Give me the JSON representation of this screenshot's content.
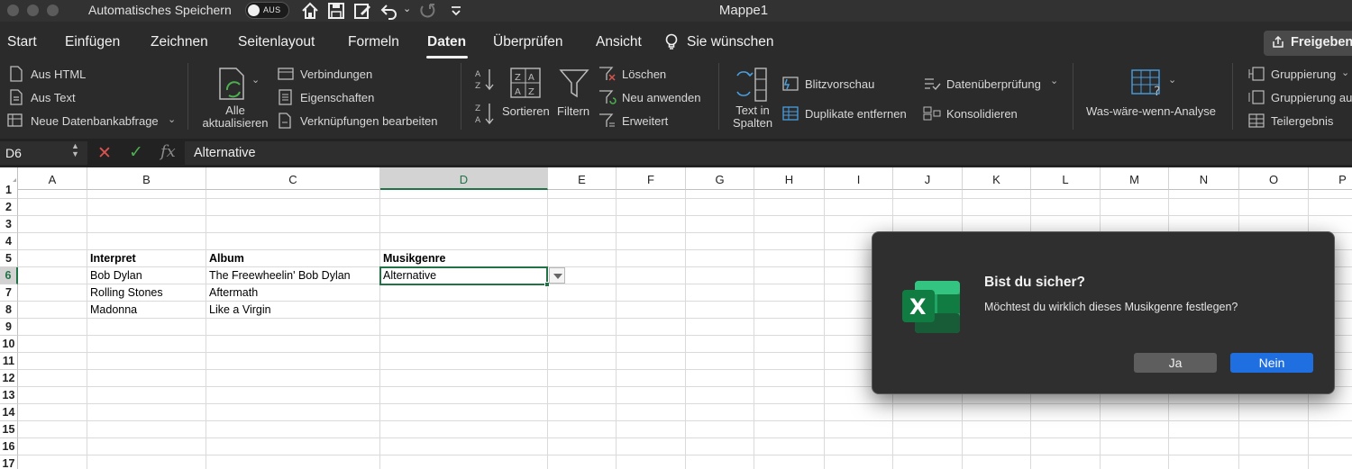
{
  "titlebar": {
    "autosave_label": "Automatisches Speichern",
    "autosave_state": "AUS",
    "doc_title": "Mappe1"
  },
  "tabs": [
    {
      "label": "Start"
    },
    {
      "label": "Einfügen"
    },
    {
      "label": "Zeichnen"
    },
    {
      "label": "Seitenlayout"
    },
    {
      "label": "Formeln"
    },
    {
      "label": "Daten",
      "active": true
    },
    {
      "label": "Überprüfen"
    },
    {
      "label": "Ansicht"
    },
    {
      "label": "Sie wünschen"
    }
  ],
  "share_label": "Freigeben",
  "ribbon": {
    "aus_html": "Aus HTML",
    "aus_text": "Aus Text",
    "neue_datenbankabfrage": "Neue Datenbankabfrage",
    "alle_aktualisieren_1": "Alle",
    "alle_aktualisieren_2": "aktualisieren",
    "verbindungen": "Verbindungen",
    "eigenschaften": "Eigenschaften",
    "verknuepfungen": "Verknüpfungen bearbeiten",
    "sortieren": "Sortieren",
    "filtern": "Filtern",
    "loeschen": "Löschen",
    "neu_anwenden": "Neu anwenden",
    "erweitert": "Erweitert",
    "text_in_1": "Text in",
    "text_in_2": "Spalten",
    "blitzvorschau": "Blitzvorschau",
    "duplikate": "Duplikate entfernen",
    "datenueberpruefung": "Datenüberprüfung",
    "konsolidieren": "Konsolidieren",
    "was_waere": "Was-wäre-wenn-Analyse",
    "gruppierung": "Gruppierung",
    "gruppierung_auf": "Gruppierung au",
    "teilergebnis": "Teilergebnis"
  },
  "formula_bar": {
    "name_box": "D6",
    "value": "Alternative"
  },
  "columns": [
    "A",
    "B",
    "C",
    "D",
    "E",
    "F",
    "G",
    "H",
    "I",
    "J",
    "K",
    "L",
    "M",
    "N",
    "O",
    "P"
  ],
  "rows": [
    "1",
    "2",
    "3",
    "4",
    "5",
    "6",
    "7",
    "8",
    "9",
    "10",
    "11",
    "12",
    "13",
    "14",
    "15",
    "16",
    "17"
  ],
  "cells": {
    "B5": "Interpret",
    "C5": "Album",
    "D5": "Musikgenre",
    "B6": "Bob Dylan",
    "C6": "The Freewheelin' Bob Dylan",
    "D6": "Alternative",
    "B7": "Rolling Stones",
    "C7": "Aftermath",
    "B8": "Madonna",
    "C8": "Like a Virgin"
  },
  "dialog": {
    "title": "Bist du sicher?",
    "message": "Möchtest du wirklich dieses Musikgenre festlegen?",
    "yes_label": "Ja",
    "no_label": "Nein"
  },
  "colors": {
    "excel_green": "#217346",
    "dialog_primary": "#1f6fe0"
  }
}
